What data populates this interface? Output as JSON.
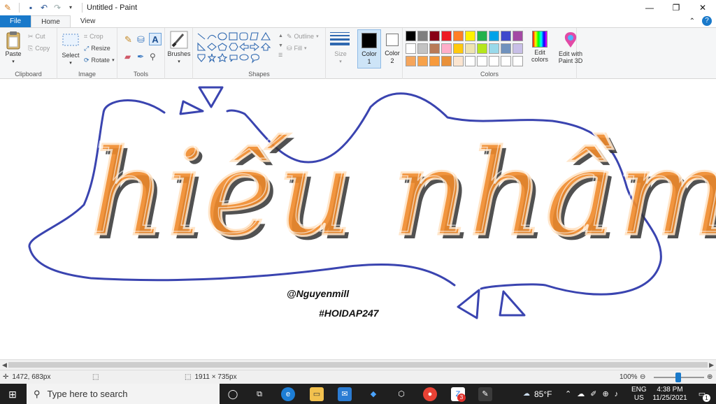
{
  "window": {
    "title": "Untitled - Paint"
  },
  "tabs": [
    {
      "label": "File"
    },
    {
      "label": "Home"
    },
    {
      "label": "View"
    }
  ],
  "ribbon": {
    "clipboard": {
      "label": "Clipboard",
      "paste": "Paste",
      "cut": "Cut",
      "copy": "Copy"
    },
    "image": {
      "label": "Image",
      "select": "Select",
      "crop": "Crop",
      "resize": "Resize",
      "rotate": "Rotate"
    },
    "tools": {
      "label": "Tools"
    },
    "brushes": {
      "label": "Brushes"
    },
    "shapes": {
      "label": "Shapes",
      "outline": "Outline",
      "fill": "Fill"
    },
    "size": {
      "label": "Size"
    },
    "color1": {
      "label": "Color",
      "num": "1"
    },
    "color2": {
      "label": "Color",
      "num": "2"
    },
    "colors": {
      "label": "Colors",
      "edit_colors_1": "Edit",
      "edit_colors_2": "colors",
      "edit_3d_1": "Edit with",
      "edit_3d_2": "Paint 3D",
      "row1": [
        "#000000",
        "#7f7f7f",
        "#880015",
        "#ed1c24",
        "#ff7f27",
        "#fff200",
        "#22b14c",
        "#00a2e8",
        "#3f48cc",
        "#a349a4"
      ],
      "row2": [
        "#ffffff",
        "#c3c3c3",
        "#b97a57",
        "#ffaec9",
        "#ffc90e",
        "#efe4b0",
        "#b5e61d",
        "#99d9ea",
        "#7092be",
        "#c8bfe7"
      ],
      "row3": [
        "#f5a55b",
        "#f7a24a",
        "#f79a3c",
        "#e9913a",
        "#fbe5d0",
        "#ffffff",
        "#ffffff",
        "#ffffff",
        "#ffffff",
        "#ffffff"
      ]
    }
  },
  "canvas": {
    "text_main": "hiếu nhầm",
    "credit": "@Nguyenmill",
    "hashtag": "#HOIDAP247",
    "outline_color": "#3a44b0",
    "ink_color": "#f08a2b"
  },
  "status": {
    "cursor_pos": "1472, 683px",
    "image_size": "1911 × 735px",
    "zoom": "100%"
  },
  "taskbar": {
    "search_placeholder": "Type here to search",
    "weather": "85°F",
    "lang1": "ENG",
    "lang2": "US",
    "time": "4:38 PM",
    "date": "11/25/2021",
    "mail_badge": "3",
    "notif_badge": "1"
  }
}
